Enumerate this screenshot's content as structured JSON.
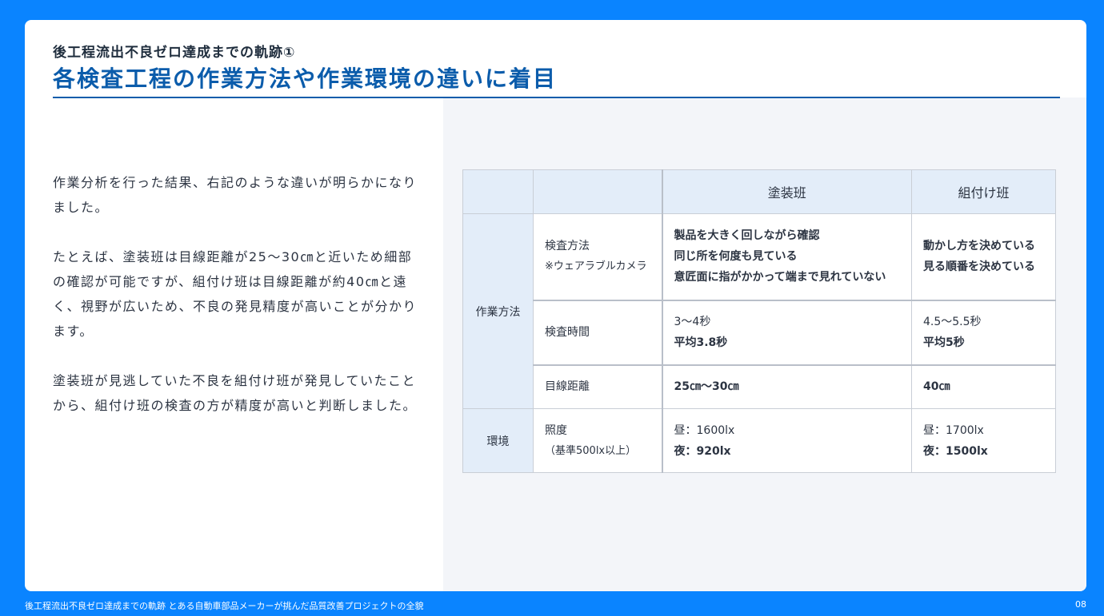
{
  "header": {
    "subtitle": "後工程流出不良ゼロ達成までの軌跡①",
    "title": "各検査工程の作業方法や作業環境の違いに着目"
  },
  "body": {
    "paragraphs": [
      "作業分析を行った結果、右記のような違いが明らかになりました。",
      "たとえば、塗装班は目線距離が25～30㎝と近いため細部の確認が可能ですが、組付け班は目線距離が約40㎝と遠く、視野が広いため、不良の発見精度が高いことが分かります。",
      "塗装班が見逃していた不良を組付け班が発見していたことから、組付け班の検査の方が精度が高いと判断しました。"
    ]
  },
  "table": {
    "columns": [
      "",
      "",
      "塗装班",
      "組付け班"
    ],
    "groups": [
      "作業方法",
      "環境"
    ],
    "rows": [
      {
        "item": [
          "検査方法",
          "※ウェアラブルカメラ"
        ],
        "painting": [
          "製品を大きく回しながら確認",
          "同じ所を何度も見ている",
          "意匠面に指がかかって端まで見れていない"
        ],
        "assembly": [
          "動かし方を決めている",
          "見る順番を決めている"
        ]
      },
      {
        "item": [
          "検査時間"
        ],
        "painting": [
          "3～4秒",
          "平均3.8秒"
        ],
        "assembly": [
          "4.5～5.5秒",
          "平均5秒"
        ]
      },
      {
        "item": [
          "目線距離"
        ],
        "painting": [
          "25㎝～30㎝"
        ],
        "assembly": [
          "40㎝"
        ]
      },
      {
        "item": [
          "照度",
          "（基準500lx以上）"
        ],
        "painting": [
          "昼：1600lx",
          "夜：920lx"
        ],
        "assembly": [
          "昼：1700lx",
          "夜：1500lx"
        ]
      }
    ]
  },
  "footer": {
    "left": "後工程流出不良ゼロ達成までの軌跡 とある自動車部品メーカーが挑んだ品質改善プロジェクトの全貌",
    "page": "08"
  },
  "colors": {
    "frame": "#0a84ff",
    "accent": "#0b5cab",
    "table_header": "#e3edf9",
    "panel": "#f3f5f9"
  }
}
